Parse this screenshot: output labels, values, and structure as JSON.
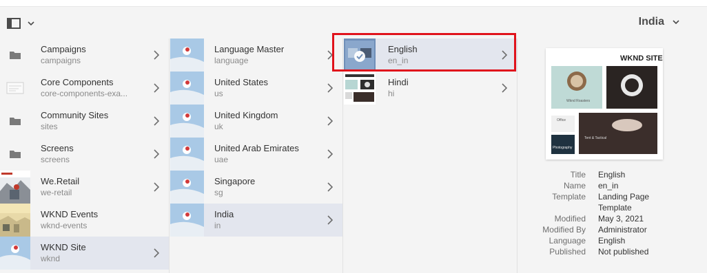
{
  "header": {
    "title": "India"
  },
  "column1": [
    {
      "title": "Campaigns",
      "sub": "campaigns",
      "thumb": "folder-icon"
    },
    {
      "title": "Core Components",
      "sub": "core-components-exa...",
      "thumb": "template-icon"
    },
    {
      "title": "Community Sites",
      "sub": "sites",
      "thumb": "folder-icon"
    },
    {
      "title": "Screens",
      "sub": "screens",
      "thumb": "folder-icon"
    },
    {
      "title": "We.Retail",
      "sub": "we-retail",
      "thumb": "we-retail-thumbnail"
    },
    {
      "title": "WKND Events",
      "sub": "wknd-events",
      "thumb": "wknd-events-thumbnail"
    },
    {
      "title": "WKND Site",
      "sub": "wknd",
      "thumb": "wknd-site-thumbnail"
    }
  ],
  "column2": [
    {
      "title": "Language Master",
      "sub": "language"
    },
    {
      "title": "United States",
      "sub": "us"
    },
    {
      "title": "United Kingdom",
      "sub": "uk"
    },
    {
      "title": "United Arab Emirates",
      "sub": "uae"
    },
    {
      "title": "Singapore",
      "sub": "sg"
    },
    {
      "title": "India",
      "sub": "in"
    }
  ],
  "column3": [
    {
      "title": "English",
      "sub": "en_in"
    },
    {
      "title": "Hindi",
      "sub": "hi"
    }
  ],
  "preview": {
    "brand": "WKND SITE",
    "card1": "Wknd Roasters",
    "card2": "Office",
    "card3": "Tent & Tactical",
    "card4": "Photography"
  },
  "meta": {
    "title_k": "Title",
    "title_v": "English",
    "name_k": "Name",
    "name_v": "en_in",
    "template_k": "Template",
    "template_v1": "Landing Page",
    "template_v2": "Template",
    "modified_k": "Modified",
    "modified_v": "May 3, 2021",
    "modby_k": "Modified By",
    "modby_v": "Administrator",
    "lang_k": "Language",
    "lang_v": "English",
    "pub_k": "Published",
    "pub_v": "Not published"
  },
  "colors": {
    "selected": "#e3e6ee",
    "highlight": "#e0121b"
  }
}
